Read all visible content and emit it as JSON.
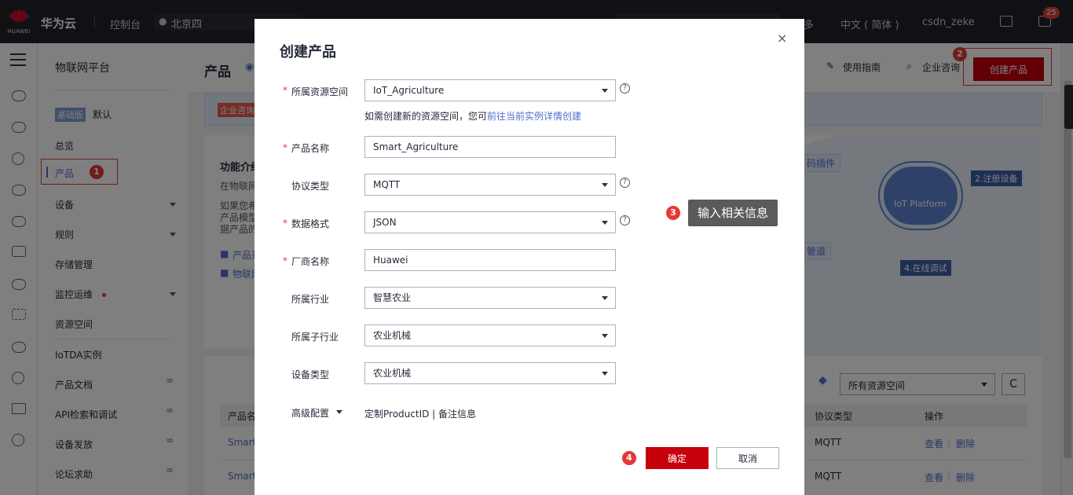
{
  "topbar": {
    "logo_text": "HUAWEI",
    "brand": "华为云",
    "console": "控制台",
    "region": "北京四",
    "more": "多",
    "language": "中文 ( 简体 )",
    "user": "csdn_zeke",
    "message_count": "25"
  },
  "nav": {
    "title": "物联网平台",
    "edition_tag": "基础版",
    "edition_value": "默认",
    "items": [
      {
        "label": "总览"
      },
      {
        "label": "产品"
      },
      {
        "label": "设备"
      },
      {
        "label": "规则"
      },
      {
        "label": "存储管理"
      },
      {
        "label": "监控运维"
      },
      {
        "label": "资源空间"
      },
      {
        "label": "IoTDA实例"
      },
      {
        "label": "产品文档"
      },
      {
        "label": "API检索和调试"
      },
      {
        "label": "设备发放"
      },
      {
        "label": "论坛求助"
      }
    ],
    "link_icon": "∞"
  },
  "steps": {
    "step1": "1",
    "step2": "2",
    "step3": "3",
    "step4": "4"
  },
  "main": {
    "page_title": "产品",
    "guide_label": "使用指南",
    "consult_label": "企业咨询",
    "create_label": "创建产品",
    "notice_tag": "企业咨询",
    "intro_title": "功能介绍",
    "intro_line1": "在物联网",
    "intro_line2": "如果您希",
    "intro_line3": "产品模型",
    "intro_line4": "据产品的",
    "intro_bullet1": "产品开",
    "intro_bullet2": "物联网",
    "art_chip1": "码插件",
    "art_chip2": "管道",
    "art_platform": "IoT Platform",
    "art_register": "2.注册设备",
    "art_debug": "4.在线调试",
    "ws_select": "所有资源空间",
    "refresh": "C",
    "table": {
      "col_name": "产品名",
      "col_protocol": "协议类型",
      "col_ops": "操作",
      "rows": [
        {
          "name": "Smart_",
          "protocol": "MQTT",
          "view": "查看",
          "delete": "删除"
        },
        {
          "name": "Smart_",
          "protocol": "MQTT",
          "view": "查看",
          "delete": "删除"
        }
      ]
    }
  },
  "modal": {
    "title": "创建产品",
    "close": "×",
    "req_mark": "*",
    "help": "?",
    "resource_space": {
      "label": "所属资源空间",
      "value": "IoT_Agriculture"
    },
    "hint_text": "如需创建新的资源空间，您可",
    "hint_link": "前往当前实例详情创建",
    "product_name": {
      "label": "产品名称",
      "value": "Smart_Agriculture"
    },
    "protocol": {
      "label": "协议类型",
      "value": "MQTT"
    },
    "data_format": {
      "label": "数据格式",
      "value": "JSON"
    },
    "vendor": {
      "label": "厂商名称",
      "value": "Huawei"
    },
    "industry": {
      "label": "所属行业",
      "value": "智慧农业"
    },
    "sub_industry": {
      "label": "所属子行业",
      "value": "农业机械"
    },
    "device_type": {
      "label": "设备类型",
      "value": "农业机械"
    },
    "advanced": {
      "label": "高级配置",
      "links": "定制ProductID | 备注信息"
    },
    "ok_label": "确定",
    "cancel_label": "取消"
  },
  "tooltip": "输入相关信息",
  "colors": {
    "accent_red": "#c7000b",
    "link_blue": "#526ecc",
    "badge_red": "#e53935"
  }
}
